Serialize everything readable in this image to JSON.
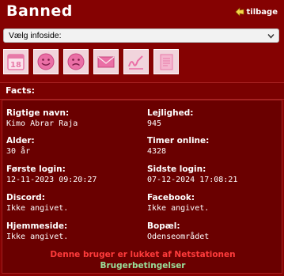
{
  "header": {
    "title": "Banned",
    "back_label": "tilbage"
  },
  "nav": {
    "select_value": "Vælg infoside:"
  },
  "iconbar": {
    "icons": [
      "calendar-icon",
      "smiley-icon",
      "sad-face-icon",
      "mail-icon",
      "signature-icon",
      "notebook-icon"
    ],
    "calendar_day": "18"
  },
  "facts": {
    "heading": "Facts:",
    "real_name_label": "Rigtige navn:",
    "real_name": "Kimo Abrar Raja",
    "apartment_label": "Lejlighed:",
    "apartment": "945",
    "age_label": "Alder:",
    "age": "30 år",
    "hours_label": "Timer online:",
    "hours": "4328",
    "first_login_label": "Første login:",
    "first_login": "12-11-2023 09:20:27",
    "last_login_label": "Sidste login:",
    "last_login": "07-12-2024 17:08:21",
    "discord_label": "Discord:",
    "discord": "Ikke angivet.",
    "facebook_label": "Facebook:",
    "facebook": "Ikke angivet.",
    "homepage_label": "Hjemmeside:",
    "homepage": "Ikke angivet.",
    "residence_label": "Bopæl:",
    "residence": "Odenseområdet"
  },
  "footer": {
    "banned_note": "Denne bruger er lukket af Netstationen",
    "terms_link": "Brugerbetingelser"
  },
  "colors": {
    "background": "#850202",
    "button_bg": "#f1d4dc",
    "icon_pink": "#ea6fa6",
    "banned_text": "#ff3b3b",
    "terms_text": "#9adf9a"
  }
}
